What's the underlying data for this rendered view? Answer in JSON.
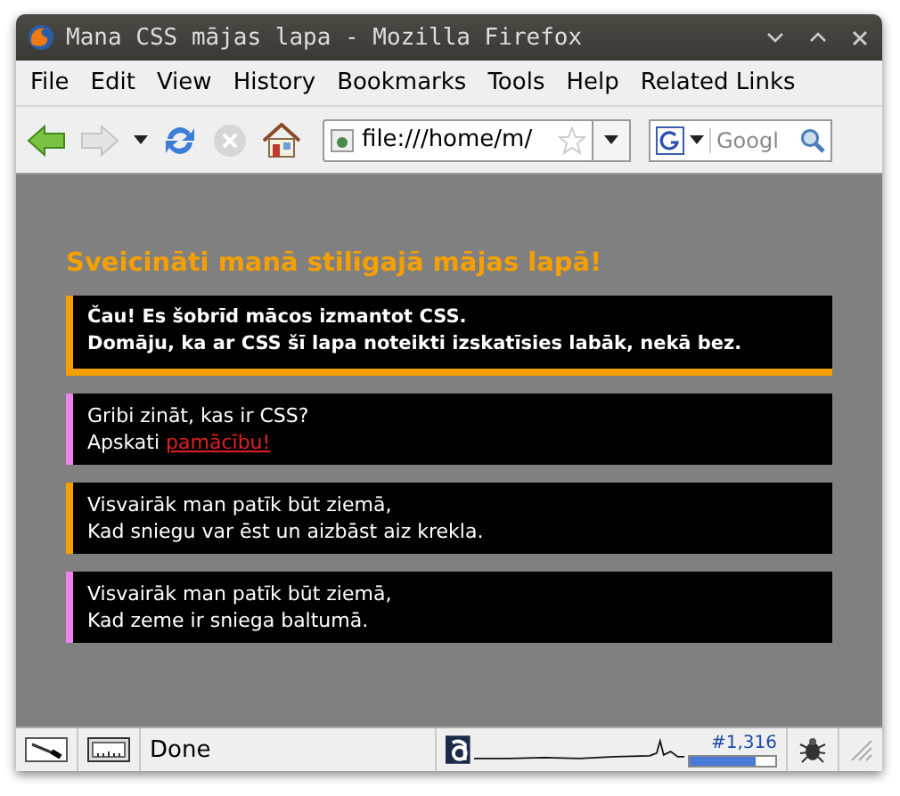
{
  "window": {
    "title": "Mana CSS mājas lapa - Mozilla Firefox"
  },
  "menu": [
    "File",
    "Edit",
    "View",
    "History",
    "Bookmarks",
    "Tools",
    "Help",
    "Related Links"
  ],
  "address": {
    "value": "file:///home/m/"
  },
  "search": {
    "placeholder": "Googl"
  },
  "page": {
    "heading": "Sveicināti manā stilīgajā mājas lapā!",
    "boxes": [
      {
        "kind": "bold",
        "color": "#f5a000",
        "lines": [
          "Čau! Es šobrīd mācos izmantot CSS.",
          "Domāju, ka ar CSS šī lapa noteikti izskatīsies labāk, nekā bez."
        ]
      },
      {
        "kind": "plain",
        "color": "#ee82ee",
        "lines": [
          "Gribi zināt, kas ir CSS?",
          "Apskati"
        ],
        "link": "pamācību!"
      },
      {
        "kind": "plain",
        "color": "#f5a000",
        "lines": [
          "Visvairāk man patīk būt ziemā,",
          "Kad sniegu var ēst un aizbāst aiz krekla."
        ]
      },
      {
        "kind": "plain",
        "color": "#ee82ee",
        "lines": [
          "Visvairāk man patīk būt ziemā,",
          "Kad zeme ir sniega baltumā."
        ]
      }
    ]
  },
  "status_bar": {
    "text": "Done",
    "counter": "#1,316",
    "level": 0.78
  }
}
